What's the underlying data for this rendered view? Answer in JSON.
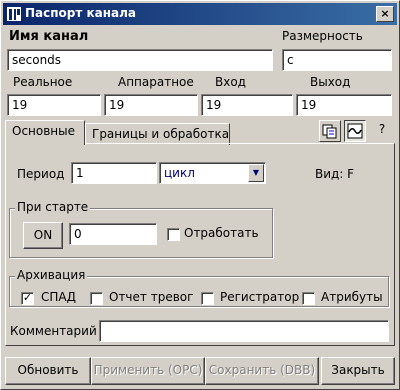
{
  "window": {
    "title": "Паспорт канала",
    "close_label": "×"
  },
  "channel_name": {
    "label": "Имя канал",
    "value": "seconds"
  },
  "dimension": {
    "label": "Размерность",
    "value": "c"
  },
  "fields": {
    "real": {
      "label": "Реальное",
      "value": "19"
    },
    "hardware": {
      "label": "Аппаратное",
      "value": "19"
    },
    "input": {
      "label": "Вход",
      "value": "19"
    },
    "output": {
      "label": "Выход",
      "value": "19"
    }
  },
  "tabs": [
    {
      "label": "Основные",
      "active": true
    },
    {
      "label": "Границы и обработка",
      "active": false
    }
  ],
  "toolbar": {
    "help_label": "?",
    "copy_icon": "copy-icon",
    "graph_icon": "graph-icon"
  },
  "period": {
    "label": "Период",
    "value": "1",
    "unit": "цикл"
  },
  "view": {
    "label": "Вид: F"
  },
  "on_start": {
    "title": "При старте",
    "on_button": "ON",
    "value": "0",
    "process_label": "Отработать",
    "process_checked": false
  },
  "archive": {
    "title": "Архивация",
    "items": [
      {
        "label": "СПАД",
        "checked": true
      },
      {
        "label": "Отчет тревог",
        "checked": false
      },
      {
        "label": "Регистратор",
        "checked": false
      },
      {
        "label": "Атрибуты",
        "checked": false
      }
    ]
  },
  "comment": {
    "label": "Комментарий",
    "value": ""
  },
  "buttons": {
    "refresh": "Обновить",
    "apply_opc": "Применить (OPC)",
    "save_dbb": "Сохранить (DBB)",
    "close": "Закрыть"
  },
  "colors": {
    "title_start": "#0a246a",
    "title_end": "#3a6ea5",
    "face": "#d4d0c8"
  }
}
